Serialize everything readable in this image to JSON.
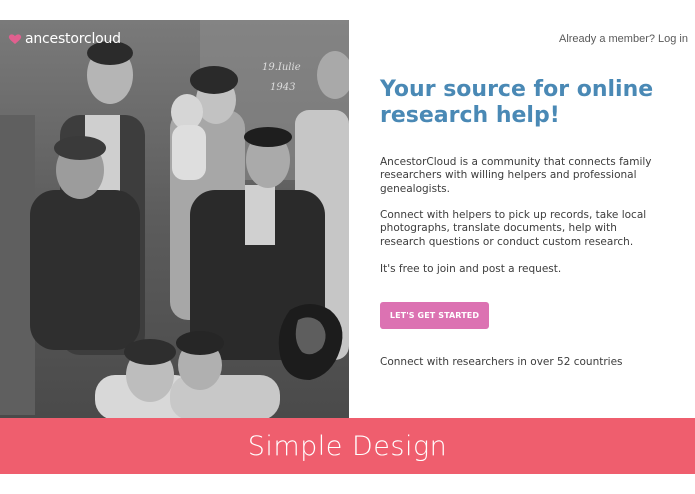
{
  "brand": {
    "logo_text": "ancestorcloud",
    "logo_icon": "heart-cloud-icon",
    "logo_color": "#e1608f"
  },
  "header": {
    "login_text": "Already a member? Log in"
  },
  "main": {
    "headline": "Your source for online research help!",
    "paragraphs": [
      "AncestorCloud is a community that connects family researchers with willing helpers and professional genealogists.",
      "Connect with helpers to pick up records, take local photographs, translate documents, help with research questions or conduct custom research.",
      "It's free to join and post a request."
    ],
    "cta_label": "LET'S GET STARTED",
    "countries_note": "Connect with researchers in over 52 countries"
  },
  "photo": {
    "handwriting": "19.Iulie 1943"
  },
  "banner": {
    "text": "Simple Design"
  },
  "colors": {
    "headline": "#4a89b5",
    "cta": "#dc72b2",
    "banner": "#ef5e6e"
  }
}
